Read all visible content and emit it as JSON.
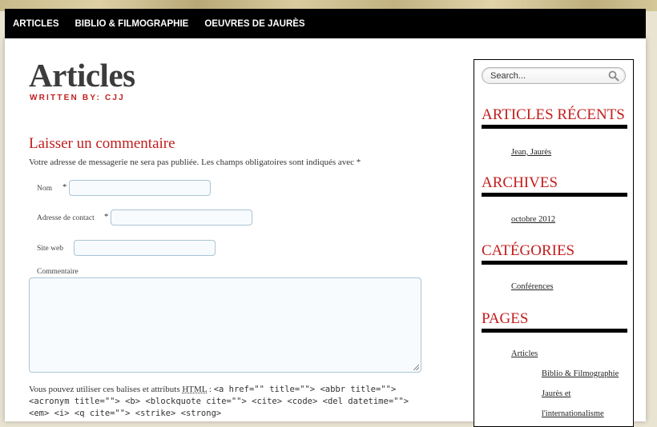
{
  "nav": {
    "items": [
      "ARTICLES",
      "BIBLIO & FILMOGRAPHIE",
      "OEUVRES DE JAURÈS"
    ]
  },
  "main": {
    "title": "Articles",
    "byline": "WRITTEN BY: CJJ",
    "comment_heading": "Laisser un commentaire",
    "comment_note": "Votre adresse de messagerie ne sera pas publiée. Les champs obligatoires sont indiqués avec *",
    "fields": {
      "name_label": "Nom",
      "contact_label": "Adresse de contact",
      "website_label": "Site web",
      "comment_label": "Commentaire",
      "required_mark": "*"
    },
    "allowed_tags_prefix": "Vous pouvez utiliser ces balises et attributs",
    "allowed_tags_abbr": "HTML",
    "allowed_tags_colon": " :",
    "allowed_tags_code": "<a href=\"\" title=\"\"> <abbr title=\"\"> <acronym title=\"\"> <b> <blockquote cite=\"\"> <cite> <code> <del datetime=\"\"> <em> <i> <q cite=\"\"> <strike> <strong>"
  },
  "sidebar": {
    "search_placeholder": "Search...",
    "widgets": [
      {
        "title": "ARTICLES RÉCENTS",
        "links": [
          "Jean, Jaurès"
        ]
      },
      {
        "title": "ARCHIVES",
        "links": [
          "octobre 2012"
        ]
      },
      {
        "title": "CATÉGORIES",
        "links": [
          "Conférences"
        ]
      },
      {
        "title": "PAGES",
        "links": [
          "Articles",
          "Biblio & Filmographie",
          "Jaurès et",
          "l'internationalisme"
        ]
      }
    ]
  },
  "colors": {
    "accent_red": "#c21d1d",
    "nav_bg": "#000000"
  }
}
